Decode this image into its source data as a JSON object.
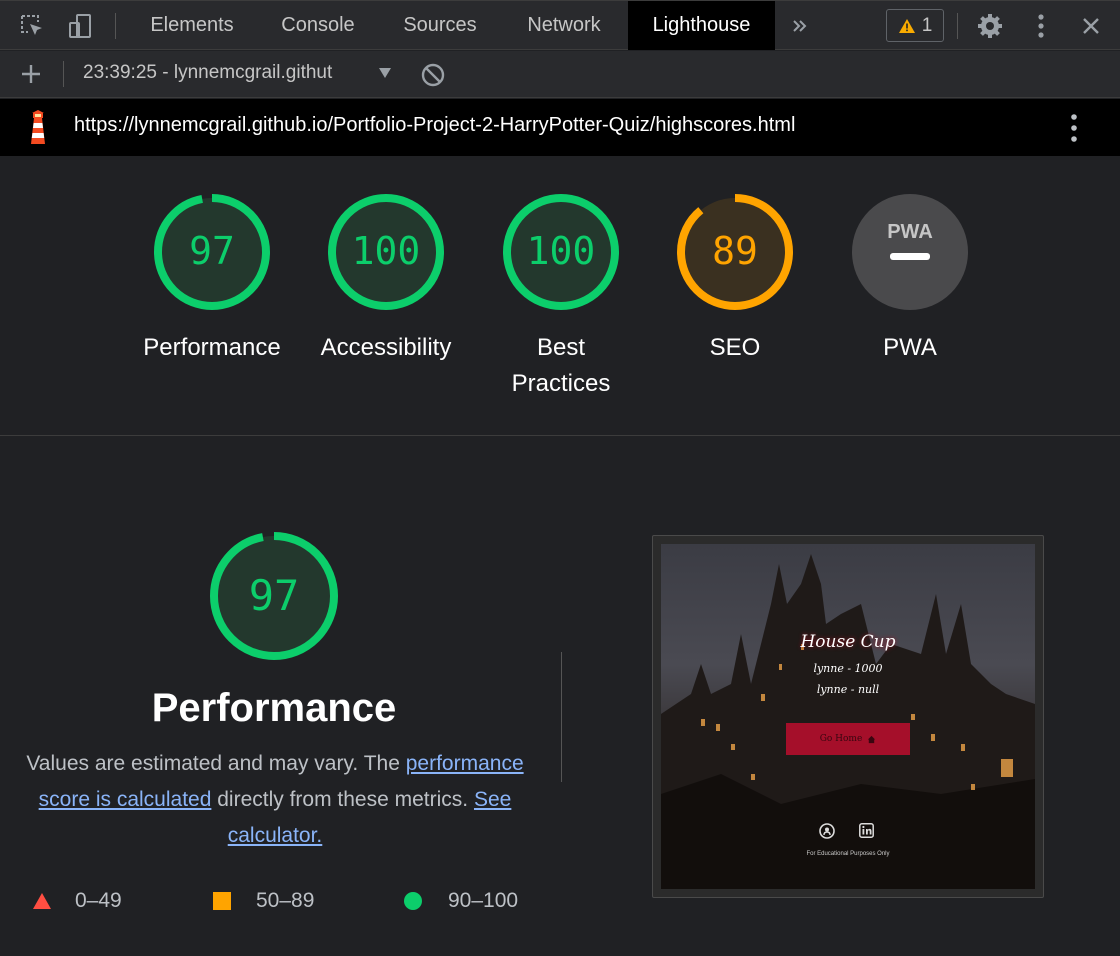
{
  "tabs": [
    {
      "label": "Elements"
    },
    {
      "label": "Console"
    },
    {
      "label": "Sources"
    },
    {
      "label": "Network"
    },
    {
      "label": "Lighthouse",
      "active": true
    }
  ],
  "toolbar": {
    "warning_count": "1",
    "run_label": "23:39:25 - lynnemcgrail.githut"
  },
  "url": "https://lynnemcgrail.github.io/Portfolio-Project-2-HarryPotter-Quiz/highscores.html",
  "gauges": [
    {
      "score": "97",
      "label": "Performance",
      "value": 97,
      "color": "#0cce6b"
    },
    {
      "score": "100",
      "label": "Accessibility",
      "value": 100,
      "color": "#0cce6b"
    },
    {
      "score": "100",
      "label": "Best Practices",
      "value": 100,
      "color": "#0cce6b"
    },
    {
      "score": "89",
      "label": "SEO",
      "value": 89,
      "color": "#ffa400"
    },
    {
      "score": "PWA",
      "label": "PWA",
      "color": "#9aa0a6"
    }
  ],
  "performance": {
    "score": "97",
    "value": 97,
    "title": "Performance",
    "desc_prefix": "Values are estimated and may vary. The",
    "link_score": "performance score is calculated",
    "desc_middle": "directly from these metrics.",
    "link_calc": "See calculator."
  },
  "legend": [
    {
      "range": "0–49",
      "shape": "triangle",
      "color": "#ff4e42"
    },
    {
      "range": "50–89",
      "shape": "square",
      "color": "#ffa400"
    },
    {
      "range": "90–100",
      "shape": "circle",
      "color": "#0cce6b"
    }
  ],
  "thumbnail": {
    "title": "House Cup",
    "scores": [
      "lynne - 1000",
      "lynne - null"
    ],
    "button": "Go Home",
    "footer": "For Educational Purposes Only"
  },
  "colors": {
    "pass": "#0cce6b",
    "average": "#ffa400",
    "fail": "#ff4e42",
    "link": "#8ab4f8"
  }
}
